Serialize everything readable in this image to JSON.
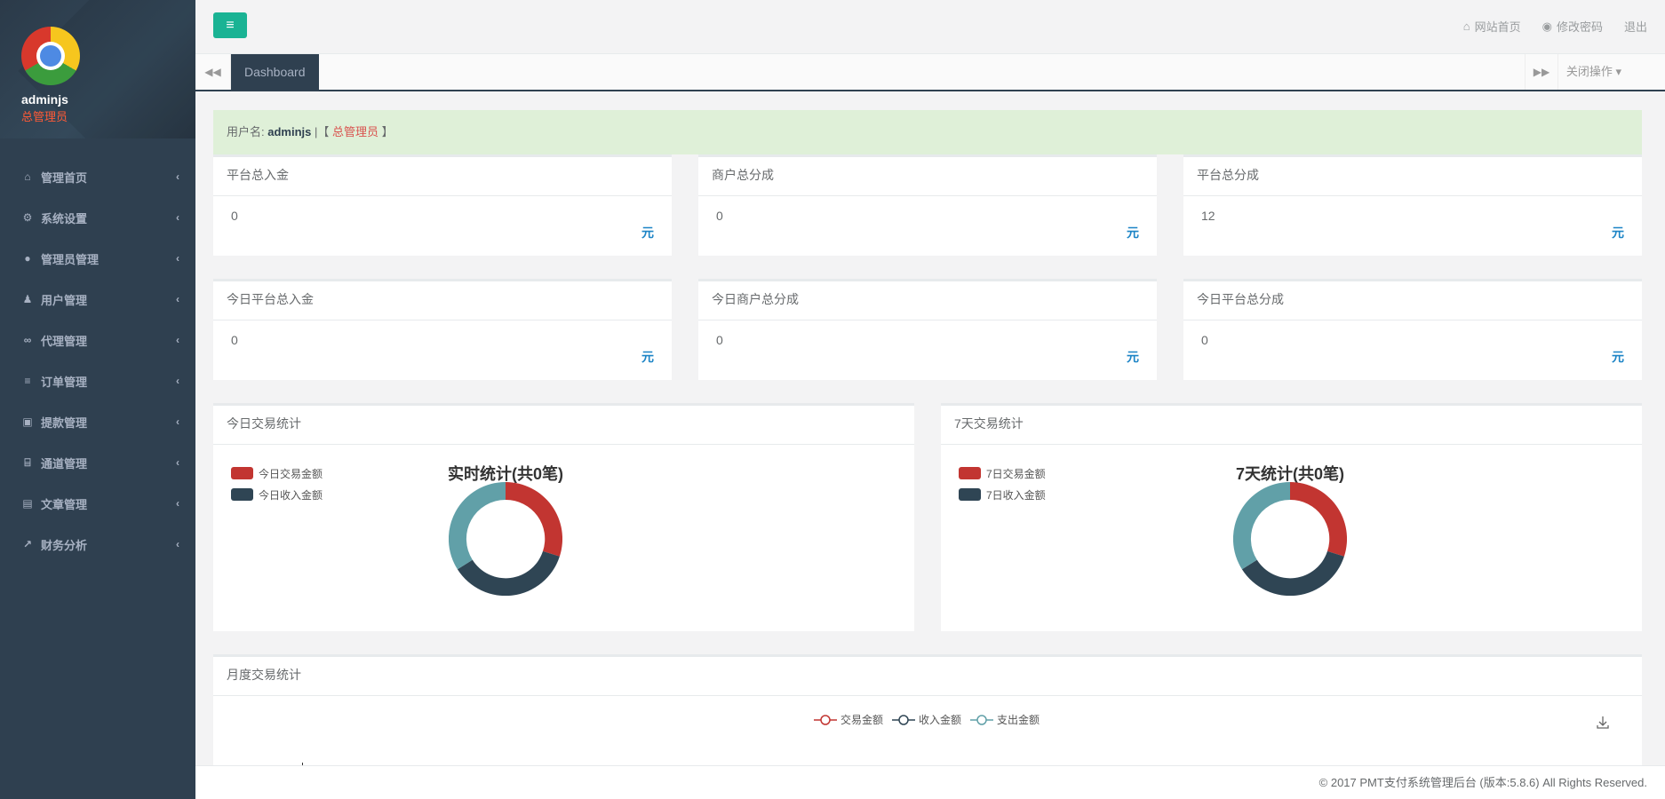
{
  "sidebar": {
    "profile": {
      "name": "adminjs",
      "role": "总管理员"
    },
    "items": [
      {
        "label": "管理首页",
        "icon": "home-icon"
      },
      {
        "label": "系统设置",
        "icon": "cogs-icon"
      },
      {
        "label": "管理员管理",
        "icon": "user-circle-icon"
      },
      {
        "label": "用户管理",
        "icon": "users-icon"
      },
      {
        "label": "代理管理",
        "icon": "handshake-icon"
      },
      {
        "label": "订单管理",
        "icon": "list-icon"
      },
      {
        "label": "提款管理",
        "icon": "lock-icon"
      },
      {
        "label": "通道管理",
        "icon": "bank-icon"
      },
      {
        "label": "文章管理",
        "icon": "book-icon"
      },
      {
        "label": "财务分析",
        "icon": "line-chart-icon"
      }
    ]
  },
  "topbar": {
    "home_link": "网站首页",
    "password_link": "修改密码",
    "logout_link": "退出"
  },
  "tabs": {
    "active": "Dashboard",
    "close_ops": "关闭操作"
  },
  "banner": {
    "user_label": "用户名:",
    "username": "adminjs",
    "sep_open": "|【",
    "role": "总管理员",
    "sep_close": "】"
  },
  "stats_row1": [
    {
      "title": "平台总入金",
      "value": "0",
      "unit": "元"
    },
    {
      "title": "商户总分成",
      "value": "0",
      "unit": "元"
    },
    {
      "title": "平台总分成",
      "value": "12",
      "unit": "元"
    }
  ],
  "stats_row2": [
    {
      "title": "今日平台总入金",
      "value": "0",
      "unit": "元"
    },
    {
      "title": "今日商户总分成",
      "value": "0",
      "unit": "元"
    },
    {
      "title": "今日平台总分成",
      "value": "0",
      "unit": "元"
    }
  ],
  "charts": {
    "today": {
      "title": "今日交易统计",
      "donut_title": "实时统计(共0笔)",
      "legend": [
        "今日交易金额",
        "今日收入金额"
      ]
    },
    "week": {
      "title": "7天交易统计",
      "donut_title": "7天统计(共0笔)",
      "legend": [
        "7日交易金额",
        "7日收入金额"
      ]
    },
    "monthly": {
      "title": "月度交易统计",
      "legend": [
        "交易金额",
        "收入金额",
        "支出金额"
      ]
    }
  },
  "colors": {
    "red": "#c23531",
    "navy": "#2f4554",
    "teal": "#61a0a8",
    "accent": "#1ab394"
  },
  "footer": {
    "text": "© 2017 PMT支付系统管理后台 (版本:5.8.6) All Rights Reserved."
  }
}
